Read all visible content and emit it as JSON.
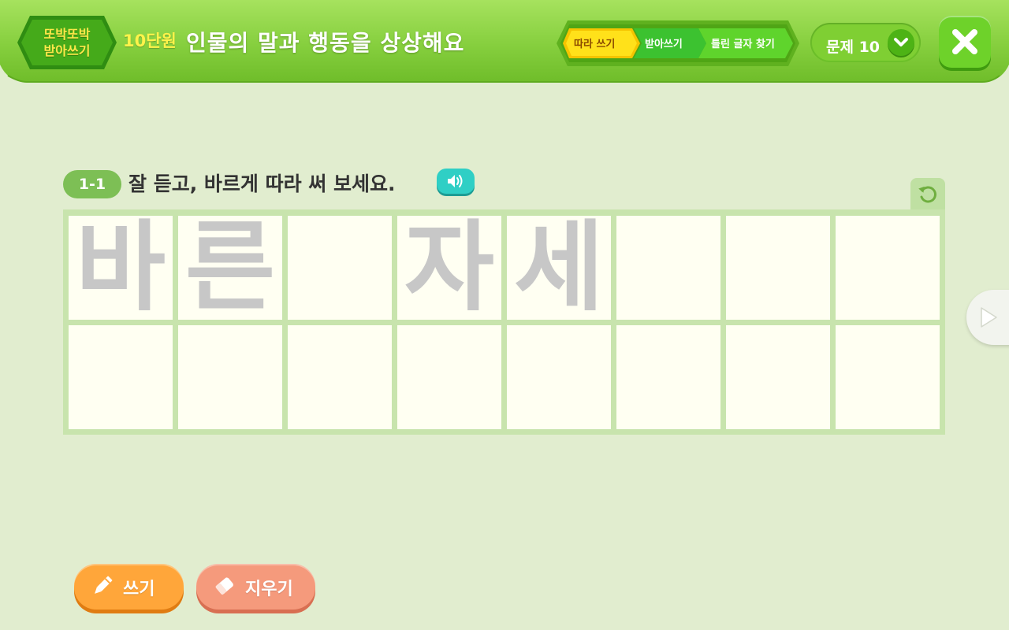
{
  "header": {
    "logo_line1": "또박또박",
    "logo_line2": "받아쓰기",
    "unit": "10단원",
    "title": "인물의 말과 행동을 상상해요"
  },
  "steps": {
    "items": [
      {
        "label": "따라 쓰기",
        "active": true
      },
      {
        "label": "받아쓰기",
        "active": false
      },
      {
        "label": "틀린 글자 찾기",
        "active": false
      }
    ]
  },
  "problem_selector": {
    "label": "문제 10"
  },
  "instruction": {
    "badge": "1-1",
    "text": "잘 듣고, 바르게 따라 써 보세요."
  },
  "grid": {
    "row1": [
      "바",
      "른",
      "",
      "자",
      "세",
      "",
      "",
      ""
    ],
    "row2": [
      "",
      "",
      "",
      "",
      "",
      "",
      "",
      ""
    ]
  },
  "buttons": {
    "write": "쓰기",
    "erase": "지우기"
  },
  "colors": {
    "header_green": "#8ad44a",
    "background": "#e1edcf",
    "guide_text": "#c7c7c7",
    "write_button": "#ffa63a",
    "erase_button": "#f59a7c",
    "speaker_button": "#2fcfc5"
  },
  "icons": {
    "close": "close-icon",
    "chevron": "chevron-down-icon",
    "speaker": "speaker-icon",
    "refresh": "refresh-icon",
    "next": "play-arrow-icon",
    "pencil": "pencil-icon",
    "eraser": "eraser-icon"
  }
}
